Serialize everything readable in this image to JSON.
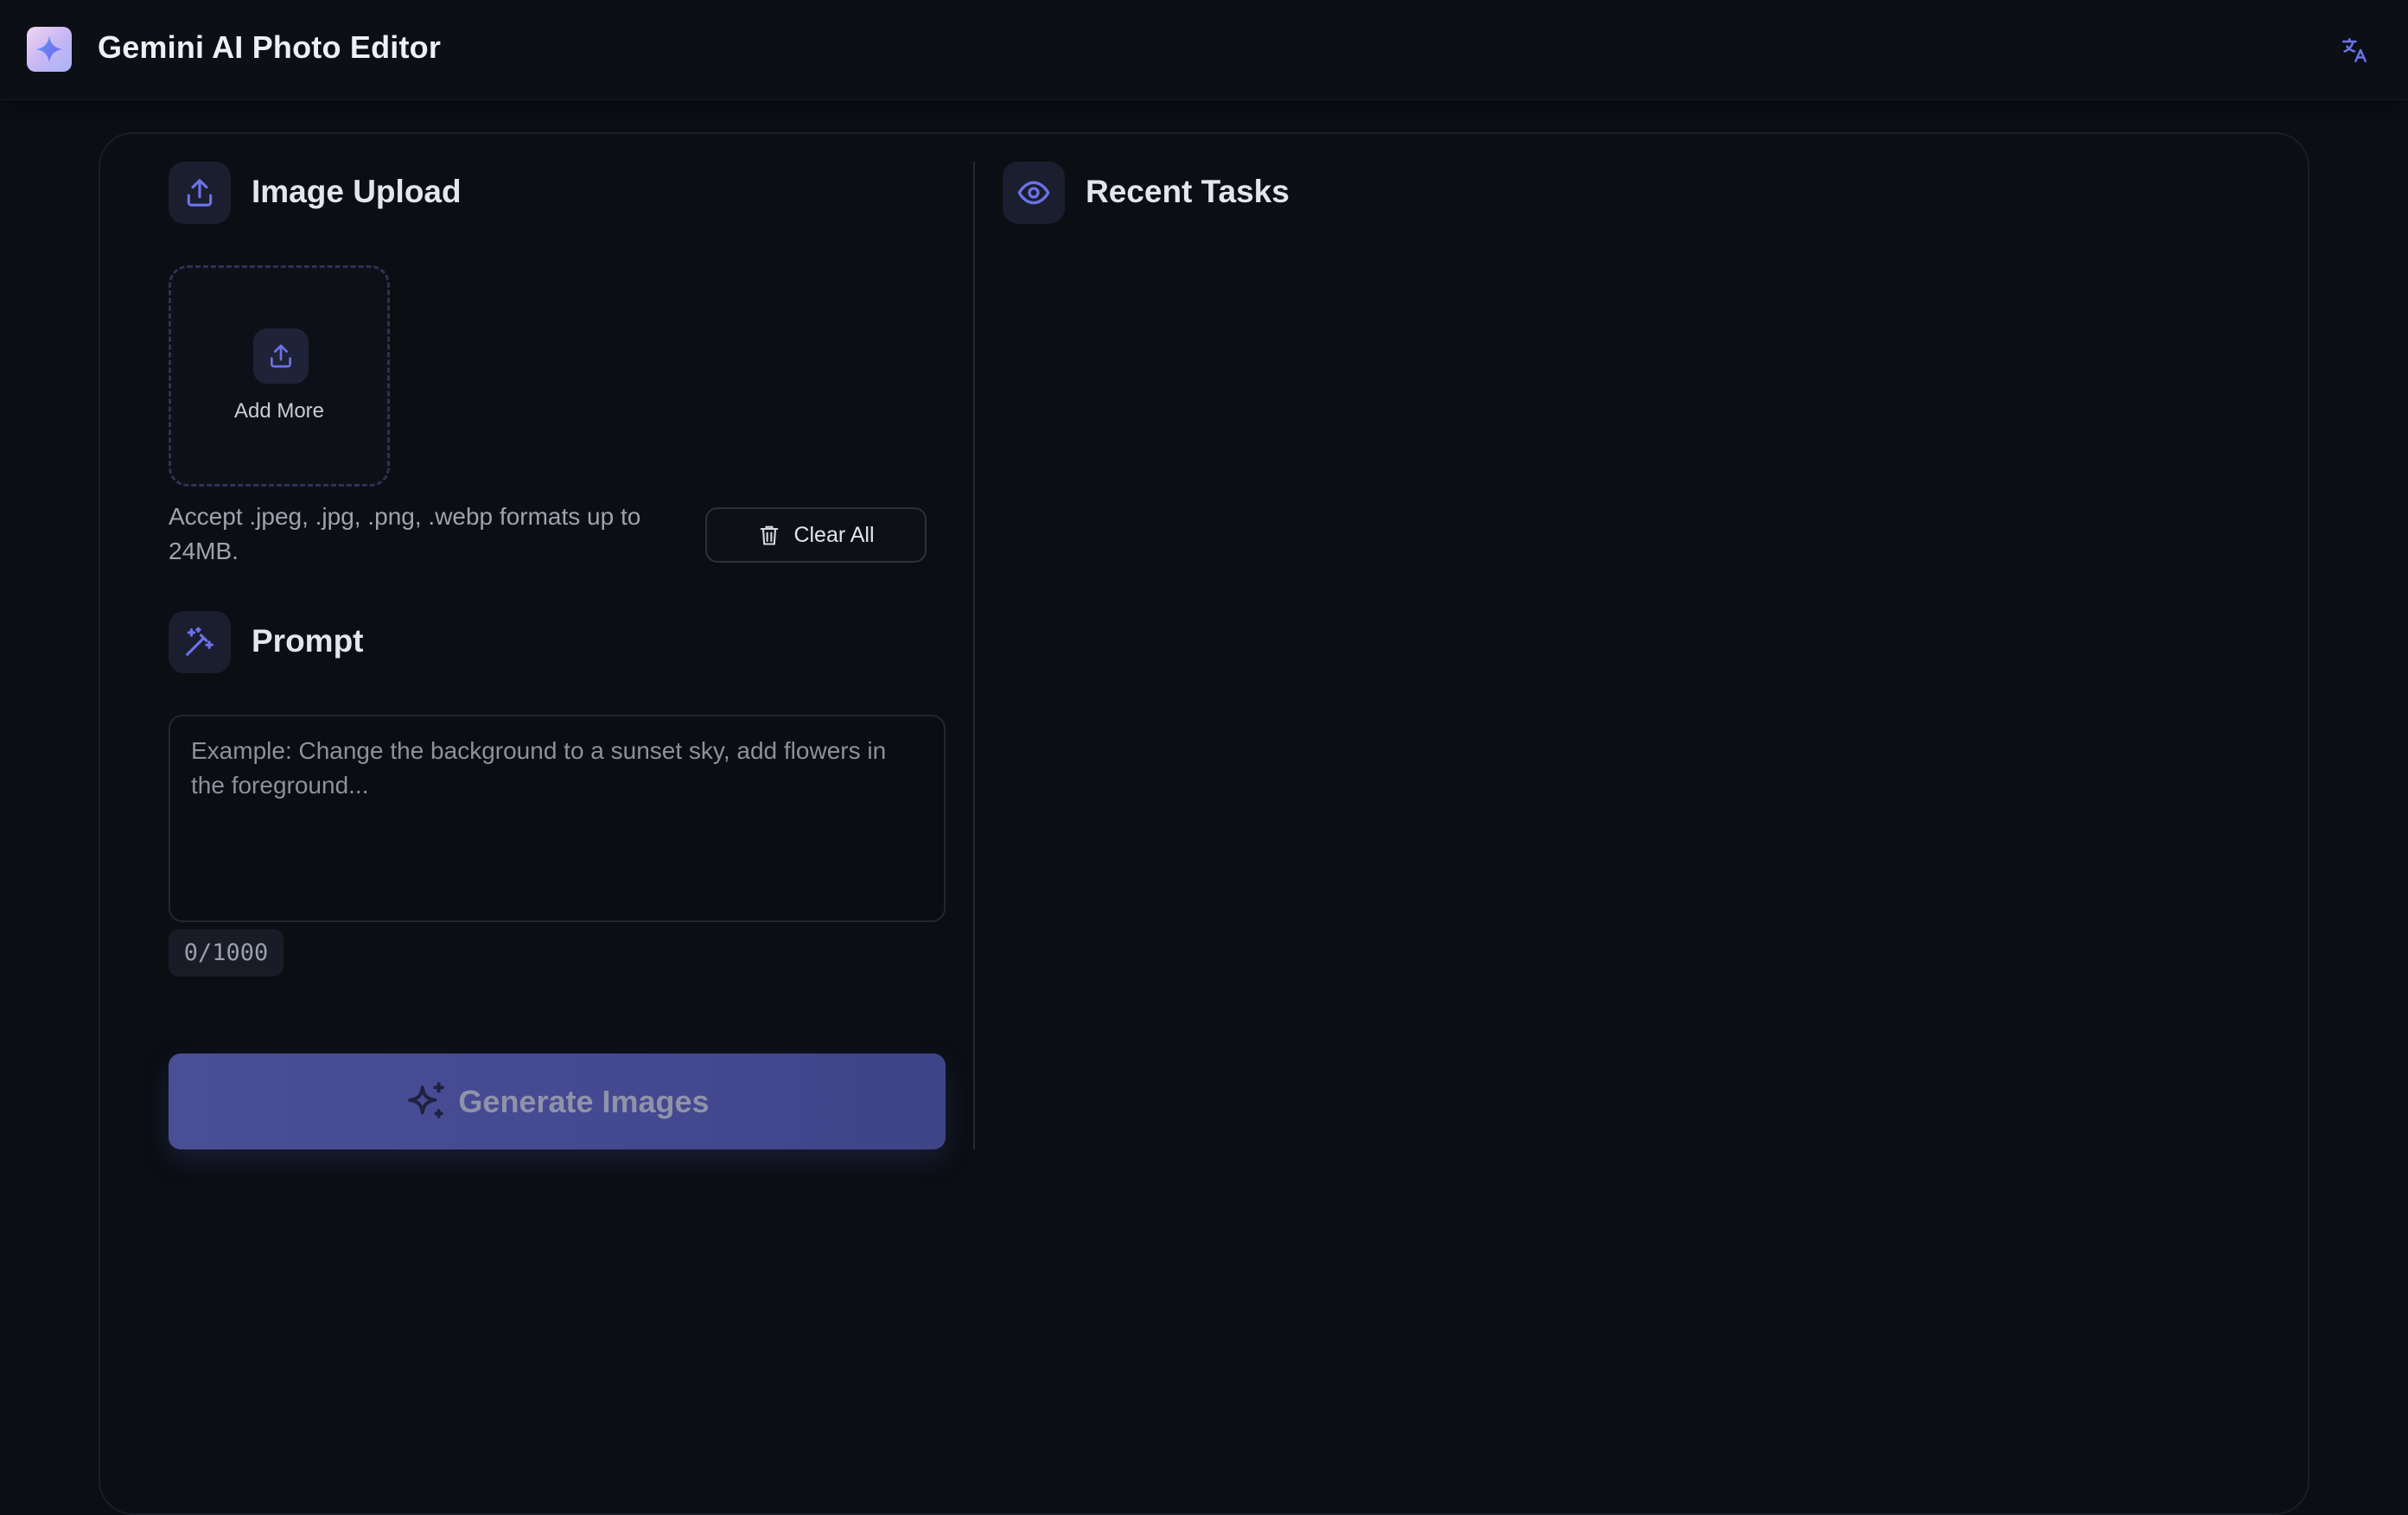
{
  "header": {
    "app_title": "Gemini AI Photo Editor",
    "logo_icon": "sparkle-icon",
    "translate_icon": "translate-icon"
  },
  "upload": {
    "section_title": "Image Upload",
    "section_icon": "upload-icon",
    "add_more_label": "Add More",
    "accept_text": "Accept .jpeg, .jpg, .png, .webp formats up to 24MB.",
    "clear_all_label": "Clear All",
    "clear_icon": "trash-icon"
  },
  "prompt": {
    "section_title": "Prompt",
    "section_icon": "magic-wand-icon",
    "value": "",
    "placeholder": "Example: Change the background to a sunset sky, add flowers in the foreground...",
    "counter": "0/1000"
  },
  "generate": {
    "label": "Generate Images",
    "icon": "sparkles-icon"
  },
  "recent": {
    "section_title": "Recent Tasks",
    "section_icon": "eye-icon"
  },
  "colors": {
    "accent": "#6b72e6",
    "background": "#0b0e13",
    "generate_button": "#4a4e94"
  }
}
